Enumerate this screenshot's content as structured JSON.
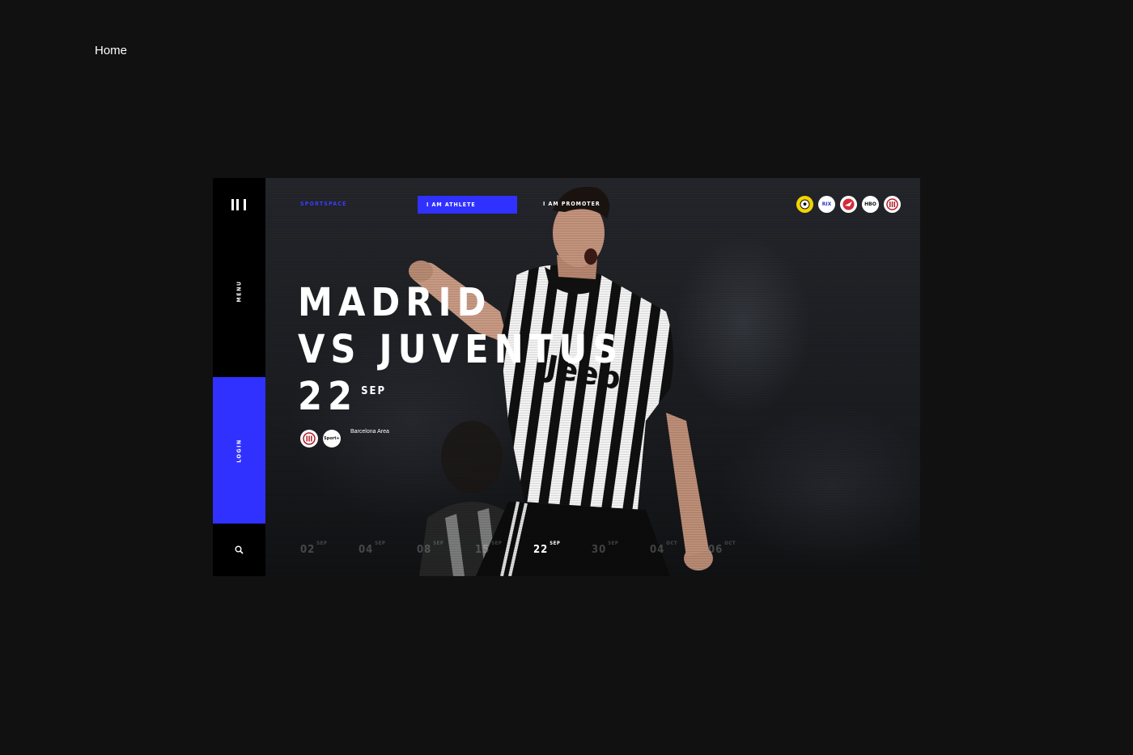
{
  "page": {
    "label": "Home"
  },
  "rail": {
    "menu_label": "MENU",
    "login_label": "LOGIN",
    "logo_icon": "bars-logo-icon",
    "search_icon": "search-icon"
  },
  "nav": {
    "brand": "SPORTSPACE",
    "athlete": "I AM ATHLETE",
    "promoter": "I AM PROMOTER"
  },
  "badges": [
    "",
    "RIX",
    "",
    "HBO",
    ""
  ],
  "hero": {
    "line1": "MADRID",
    "line2": "VS JUVENTUS",
    "day": "22",
    "month": "SEP",
    "sponsors": [
      "",
      "Sport+"
    ],
    "location": "Barcelona Area"
  },
  "dates": [
    {
      "day": "02",
      "month": "SEP",
      "active": false
    },
    {
      "day": "04",
      "month": "SEP",
      "active": false
    },
    {
      "day": "08",
      "month": "SEP",
      "active": false
    },
    {
      "day": "15",
      "month": "SEP",
      "active": false
    },
    {
      "day": "22",
      "month": "SEP",
      "active": true
    },
    {
      "day": "30",
      "month": "SEP",
      "active": false
    },
    {
      "day": "04",
      "month": "OCT",
      "active": false
    },
    {
      "day": "06",
      "month": "OCT",
      "active": false
    }
  ],
  "colors": {
    "accent": "#3131ff",
    "background": "#111112",
    "rail": "#000000"
  }
}
